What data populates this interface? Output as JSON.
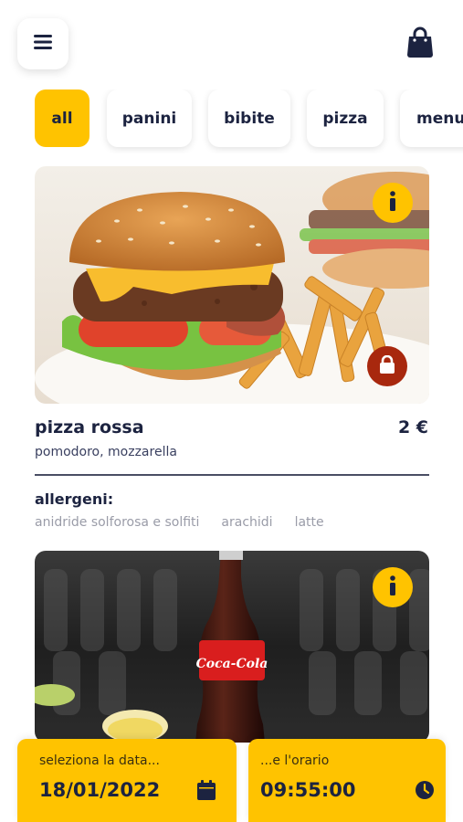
{
  "header": {
    "menu_icon": "hamburger-menu-icon",
    "bag_icon": "shopping-bag-icon"
  },
  "tabs": [
    {
      "label": "all",
      "active": true
    },
    {
      "label": "panini",
      "active": false
    },
    {
      "label": "bibite",
      "active": false
    },
    {
      "label": "pizza",
      "active": false
    },
    {
      "label": "menu",
      "active": false
    }
  ],
  "products": [
    {
      "image": "burger-and-fries-photo",
      "name": "pizza rossa",
      "price": "2 €",
      "description": "pomodoro, mozzarella",
      "allergens_title": "allergeni:",
      "allergens": [
        "anidride solforosa e solfiti",
        "arachidi",
        "latte"
      ],
      "badges": [
        "info-icon",
        "lock-icon"
      ]
    },
    {
      "image": "coca-cola-bottle-photo",
      "badges": [
        "info-icon"
      ],
      "bottle_label": "Coca-Cola"
    }
  ],
  "bottom_bar": {
    "date_label": "seleziona la data...",
    "date_value": "18/01/2022",
    "date_icon": "calendar-icon",
    "time_label": "...e l'orario",
    "time_value": "09:55:00",
    "time_icon": "clock-icon"
  },
  "colors": {
    "accent": "#ffc300",
    "text": "#1c2340",
    "lock_badge": "#a8280e"
  }
}
